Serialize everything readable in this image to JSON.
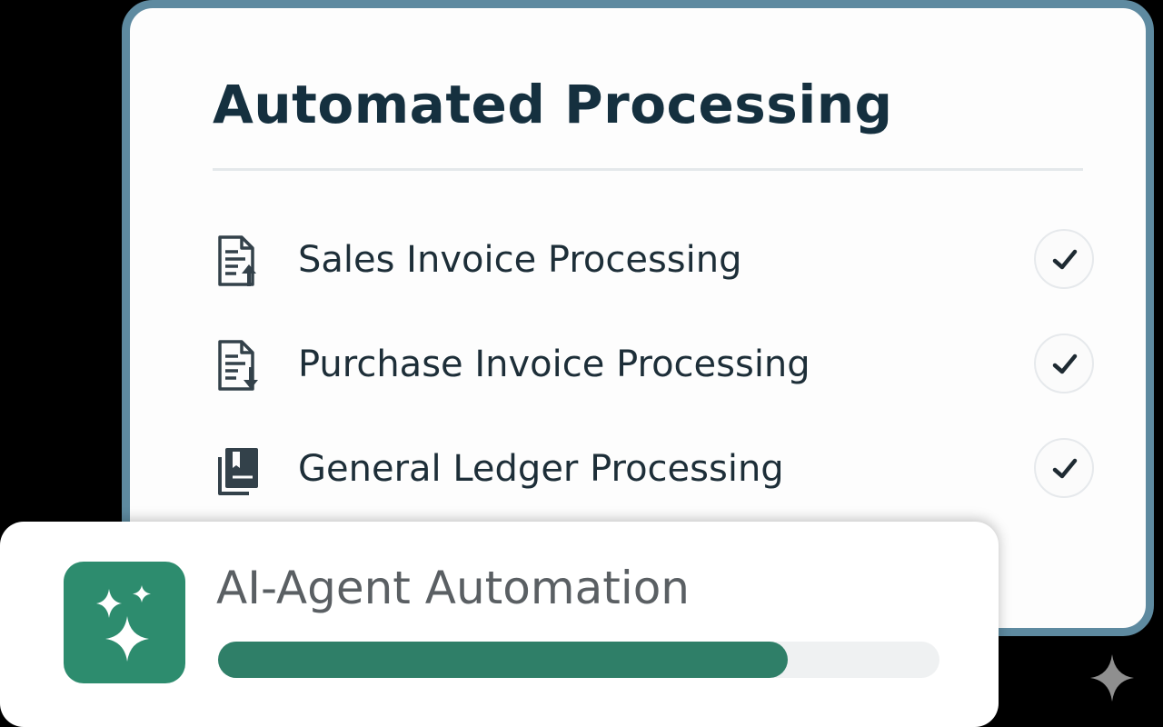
{
  "main_card": {
    "title": "Automated Processing",
    "items": [
      {
        "label": "Sales Invoice Processing",
        "icon": "document-upload-icon",
        "checked": true
      },
      {
        "label": "Purchase Invoice Processing",
        "icon": "document-download-icon",
        "checked": true
      },
      {
        "label": "General Ledger Processing",
        "icon": "ledger-book-icon",
        "checked": true
      }
    ]
  },
  "agent_card": {
    "title": "AI-Agent Automation",
    "icon": "sparkles-icon",
    "progress": 0.79
  },
  "colors": {
    "card_border": "#5e8aa0",
    "title_text": "#15303f",
    "accent_green": "#2d8c6e",
    "progress_fill": "#2f7f68",
    "progress_track": "#eff1f2"
  },
  "corner_icon": "sparkle-icon"
}
